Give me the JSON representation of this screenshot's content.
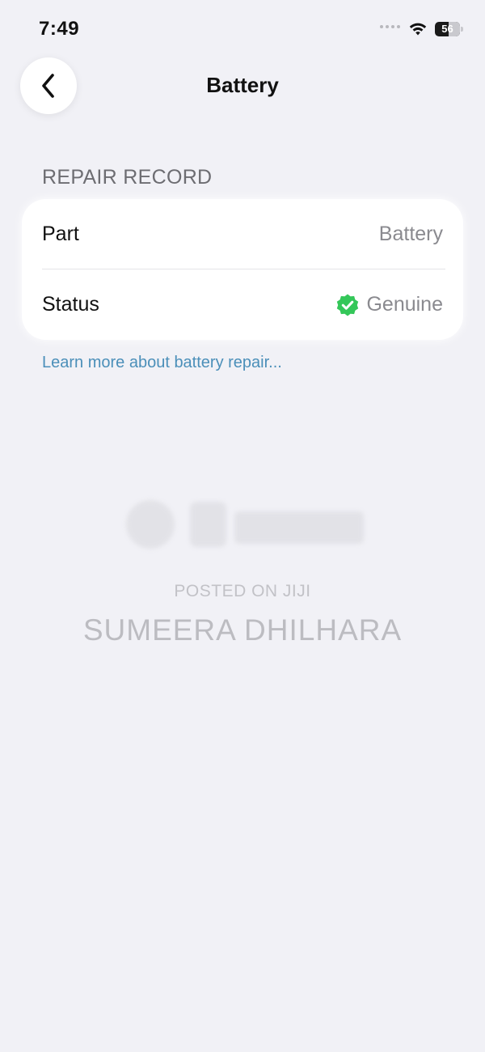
{
  "status_bar": {
    "time": "7:49",
    "battery_level": "56",
    "battery_percent": 56,
    "icons": [
      "signal-dots-icon",
      "wifi-icon",
      "battery-icon"
    ]
  },
  "nav": {
    "back_icon": "chevron-left-icon",
    "title": "Battery"
  },
  "repair_record": {
    "header": "REPAIR RECORD",
    "rows": [
      {
        "label": "Part",
        "value": "Battery"
      },
      {
        "label": "Status",
        "value": "Genuine",
        "icon": "verified-check-icon",
        "icon_color": "#34c759"
      }
    ],
    "link": "Learn more about battery repair..."
  },
  "watermark": {
    "posted": "POSTED ON JIJI",
    "name": "SUMEERA DHILHARA"
  },
  "colors": {
    "background": "#f1f1f6",
    "link": "#4b8fb9",
    "verified": "#34c759"
  }
}
